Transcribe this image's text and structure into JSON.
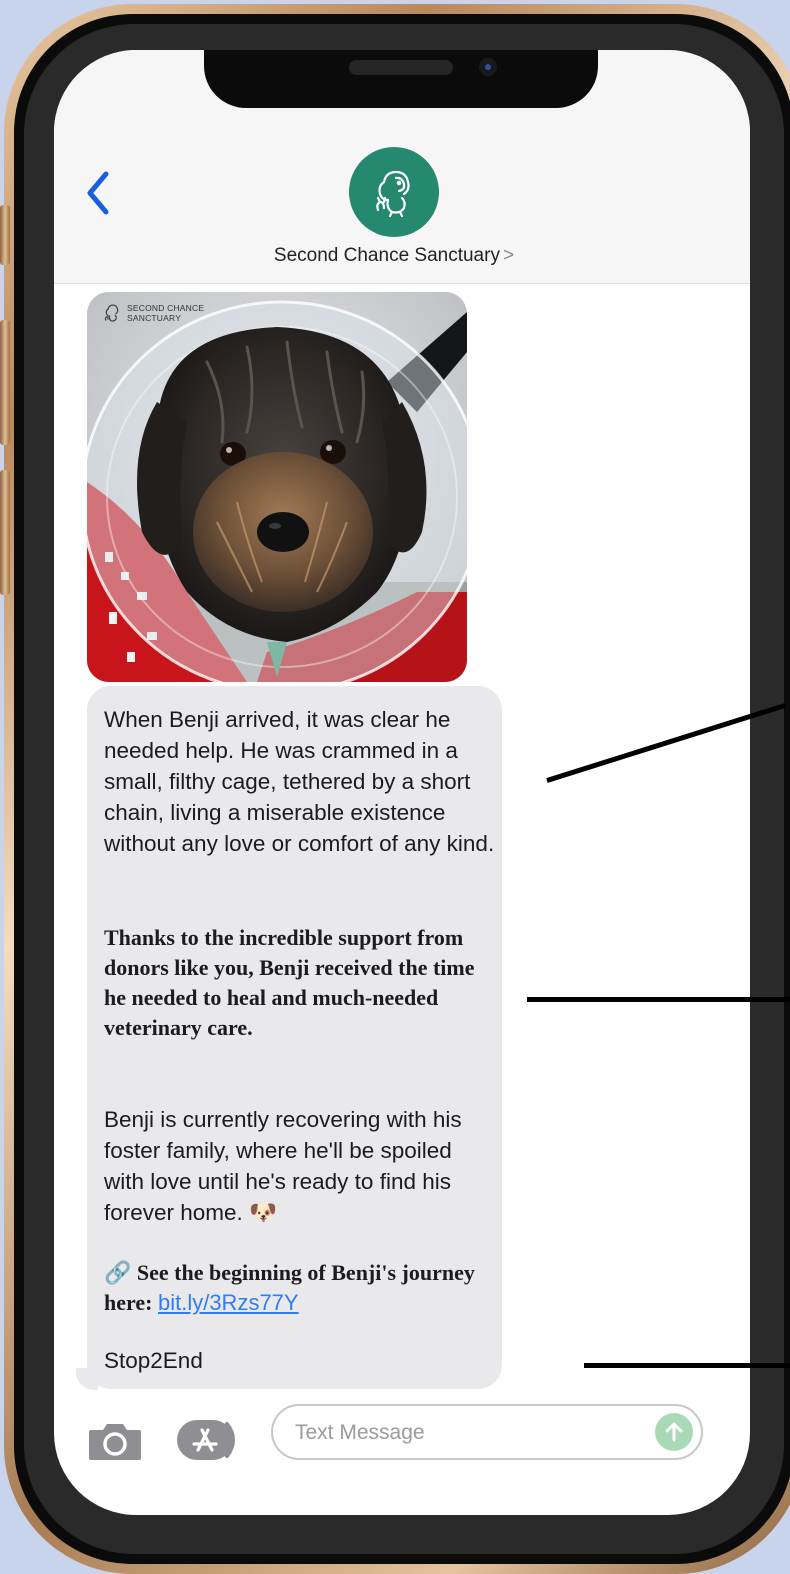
{
  "conversation": {
    "contact_name": "Second Chance Sanctuary",
    "contact_chevron": ">",
    "avatar_icon": "dog-cat-logo-icon",
    "back_icon": "chevron-left-icon"
  },
  "photo": {
    "watermark_line1": "SECOND CHANCE",
    "watermark_line2": "SANCTUARY",
    "description_icon": "dog-photo"
  },
  "message": {
    "p1": "When Benji arrived, it was clear he needed help. He was crammed in a small, filthy cage, tethered by a short chain, living a miserable existence without any love or comfort of any kind.",
    "p2": "Thanks to the incredible support from donors like you, Benji received the time he needed to heal and much-needed veterinary care.",
    "p3": "Benji is currently recovering with his foster family, where he'll be spoiled with love until he's ready to find his forever home. 🐶",
    "p4_emoji": "🔗",
    "p4_text": " See the beginning of Benji's journey here",
    "p4_colon": ": ",
    "p4_link": "bit.ly/3Rzs77Y",
    "p5": "Stop2End"
  },
  "input_bar": {
    "placeholder": "Text Message",
    "camera_icon": "camera-icon",
    "apps_icon": "app-store-icon",
    "send_icon": "arrow-up-icon"
  },
  "colors": {
    "background": "#c8d4ec",
    "avatar": "#24896f",
    "bubble": "#e9e9eb",
    "link": "#2f7cf6",
    "back_chevron": "#1a5ee0",
    "send_button": "#a9dab8"
  }
}
